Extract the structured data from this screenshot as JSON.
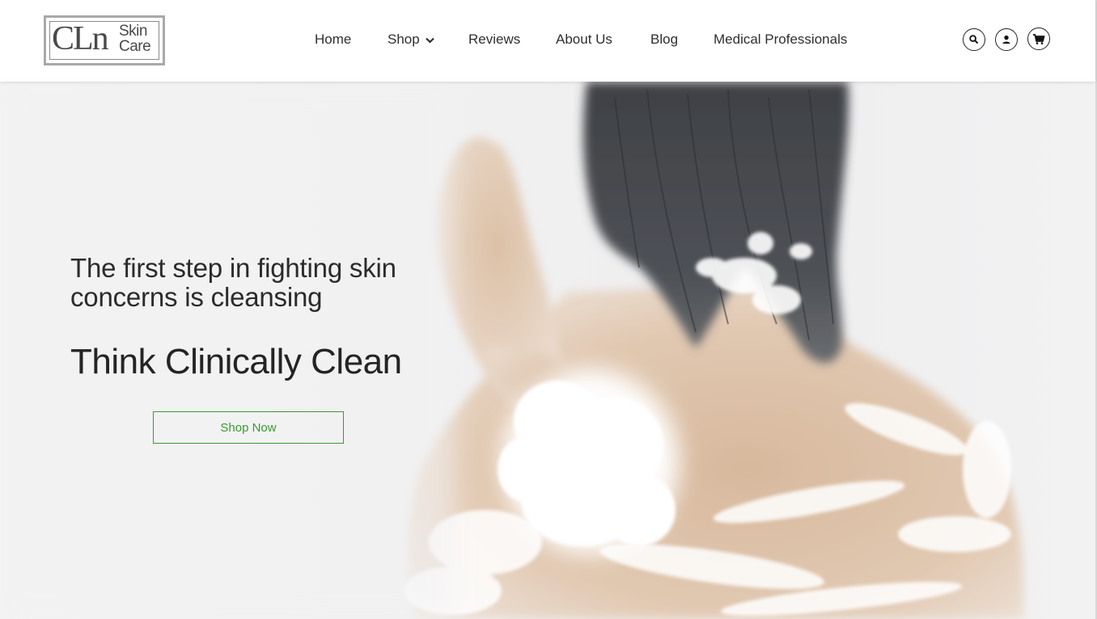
{
  "brand": {
    "logo_mark": "CLn",
    "logo_line1": "Skin",
    "logo_line2": "Care"
  },
  "nav": {
    "items": [
      {
        "label": "Home"
      },
      {
        "label": "Shop",
        "has_dropdown": true
      },
      {
        "label": "Reviews"
      },
      {
        "label": "About Us"
      },
      {
        "label": "Blog"
      },
      {
        "label": "Medical Professionals"
      }
    ]
  },
  "header_icons": [
    "search-icon",
    "account-icon",
    "cart-icon"
  ],
  "hero": {
    "tagline": "The first step in fighting skin concerns is cleansing",
    "headline": "Think Clinically Clean",
    "cta_label": "Shop Now"
  },
  "colors": {
    "accent": "#3a9a32",
    "text": "#2a2a2a",
    "header_bg": "#ffffff"
  }
}
